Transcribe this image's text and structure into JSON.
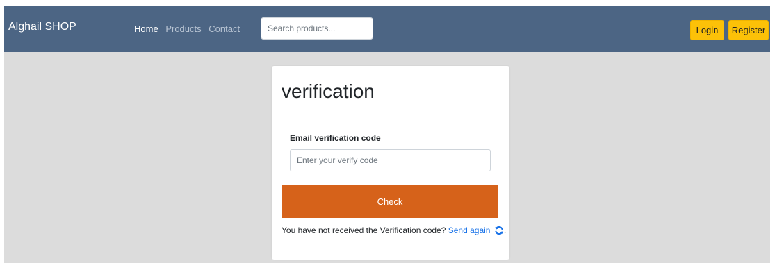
{
  "navbar": {
    "brand": "Alghail SHOP",
    "links": [
      "Home",
      "Products",
      "Contact"
    ],
    "search_placeholder": "Search products...",
    "login_label": "Login",
    "register_label": "Register",
    "bg_color": "#4c6584",
    "button_color": "#fcc108"
  },
  "card": {
    "title": "verification",
    "field_label": "Email verification code",
    "input_placeholder": "Enter your verify code",
    "input_value": "",
    "check_label": "Check",
    "check_color": "#d6621a",
    "resend_text": "You have not received the Verification code?",
    "resend_link": "Send again",
    "resend_suffix": ".",
    "refresh_icon": "refresh-icon"
  }
}
